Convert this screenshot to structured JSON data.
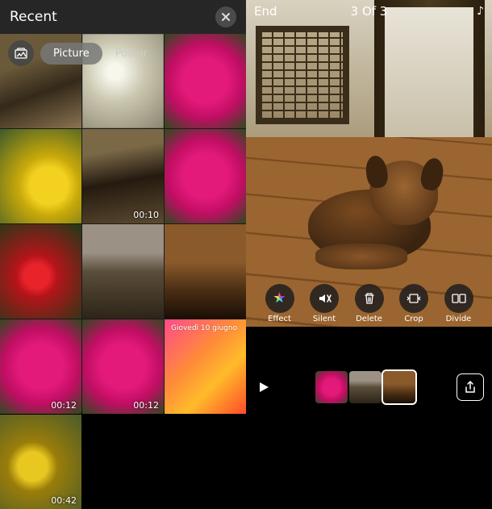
{
  "leftPanel": {
    "title": "Recent",
    "filters": {
      "picture": "Picture",
      "poster": "Poster"
    },
    "thumbs": [
      {
        "kind": "room",
        "duration": ""
      },
      {
        "kind": "blur",
        "duration": ""
      },
      {
        "kind": "flower-pink",
        "duration": ""
      },
      {
        "kind": "yellow",
        "duration": ""
      },
      {
        "kind": "room2",
        "duration": "00:10"
      },
      {
        "kind": "flower-pink",
        "duration": ""
      },
      {
        "kind": "red-flower",
        "duration": ""
      },
      {
        "kind": "cat",
        "duration": ""
      },
      {
        "kind": "dog",
        "duration": ""
      },
      {
        "kind": "flower-pink",
        "duration": "00:12"
      },
      {
        "kind": "flower-pink",
        "duration": "00:12"
      },
      {
        "kind": "wave",
        "duration": "",
        "caption": "Giovedì 10 giugno"
      },
      {
        "kind": "yellow2",
        "duration": "00:42"
      },
      {
        "kind": "blank",
        "duration": ""
      },
      {
        "kind": "blank",
        "duration": ""
      }
    ]
  },
  "rightPanel": {
    "endLabel": "End",
    "counter": "3 Of 3",
    "actions": {
      "effect": "Effect",
      "silent": "Silent",
      "delete": "Delete",
      "crop": "Crop",
      "divide": "Divide"
    },
    "clips": [
      {
        "kind": "flower-pink",
        "selected": false
      },
      {
        "kind": "cat",
        "selected": false
      },
      {
        "kind": "dog",
        "selected": true
      }
    ]
  }
}
